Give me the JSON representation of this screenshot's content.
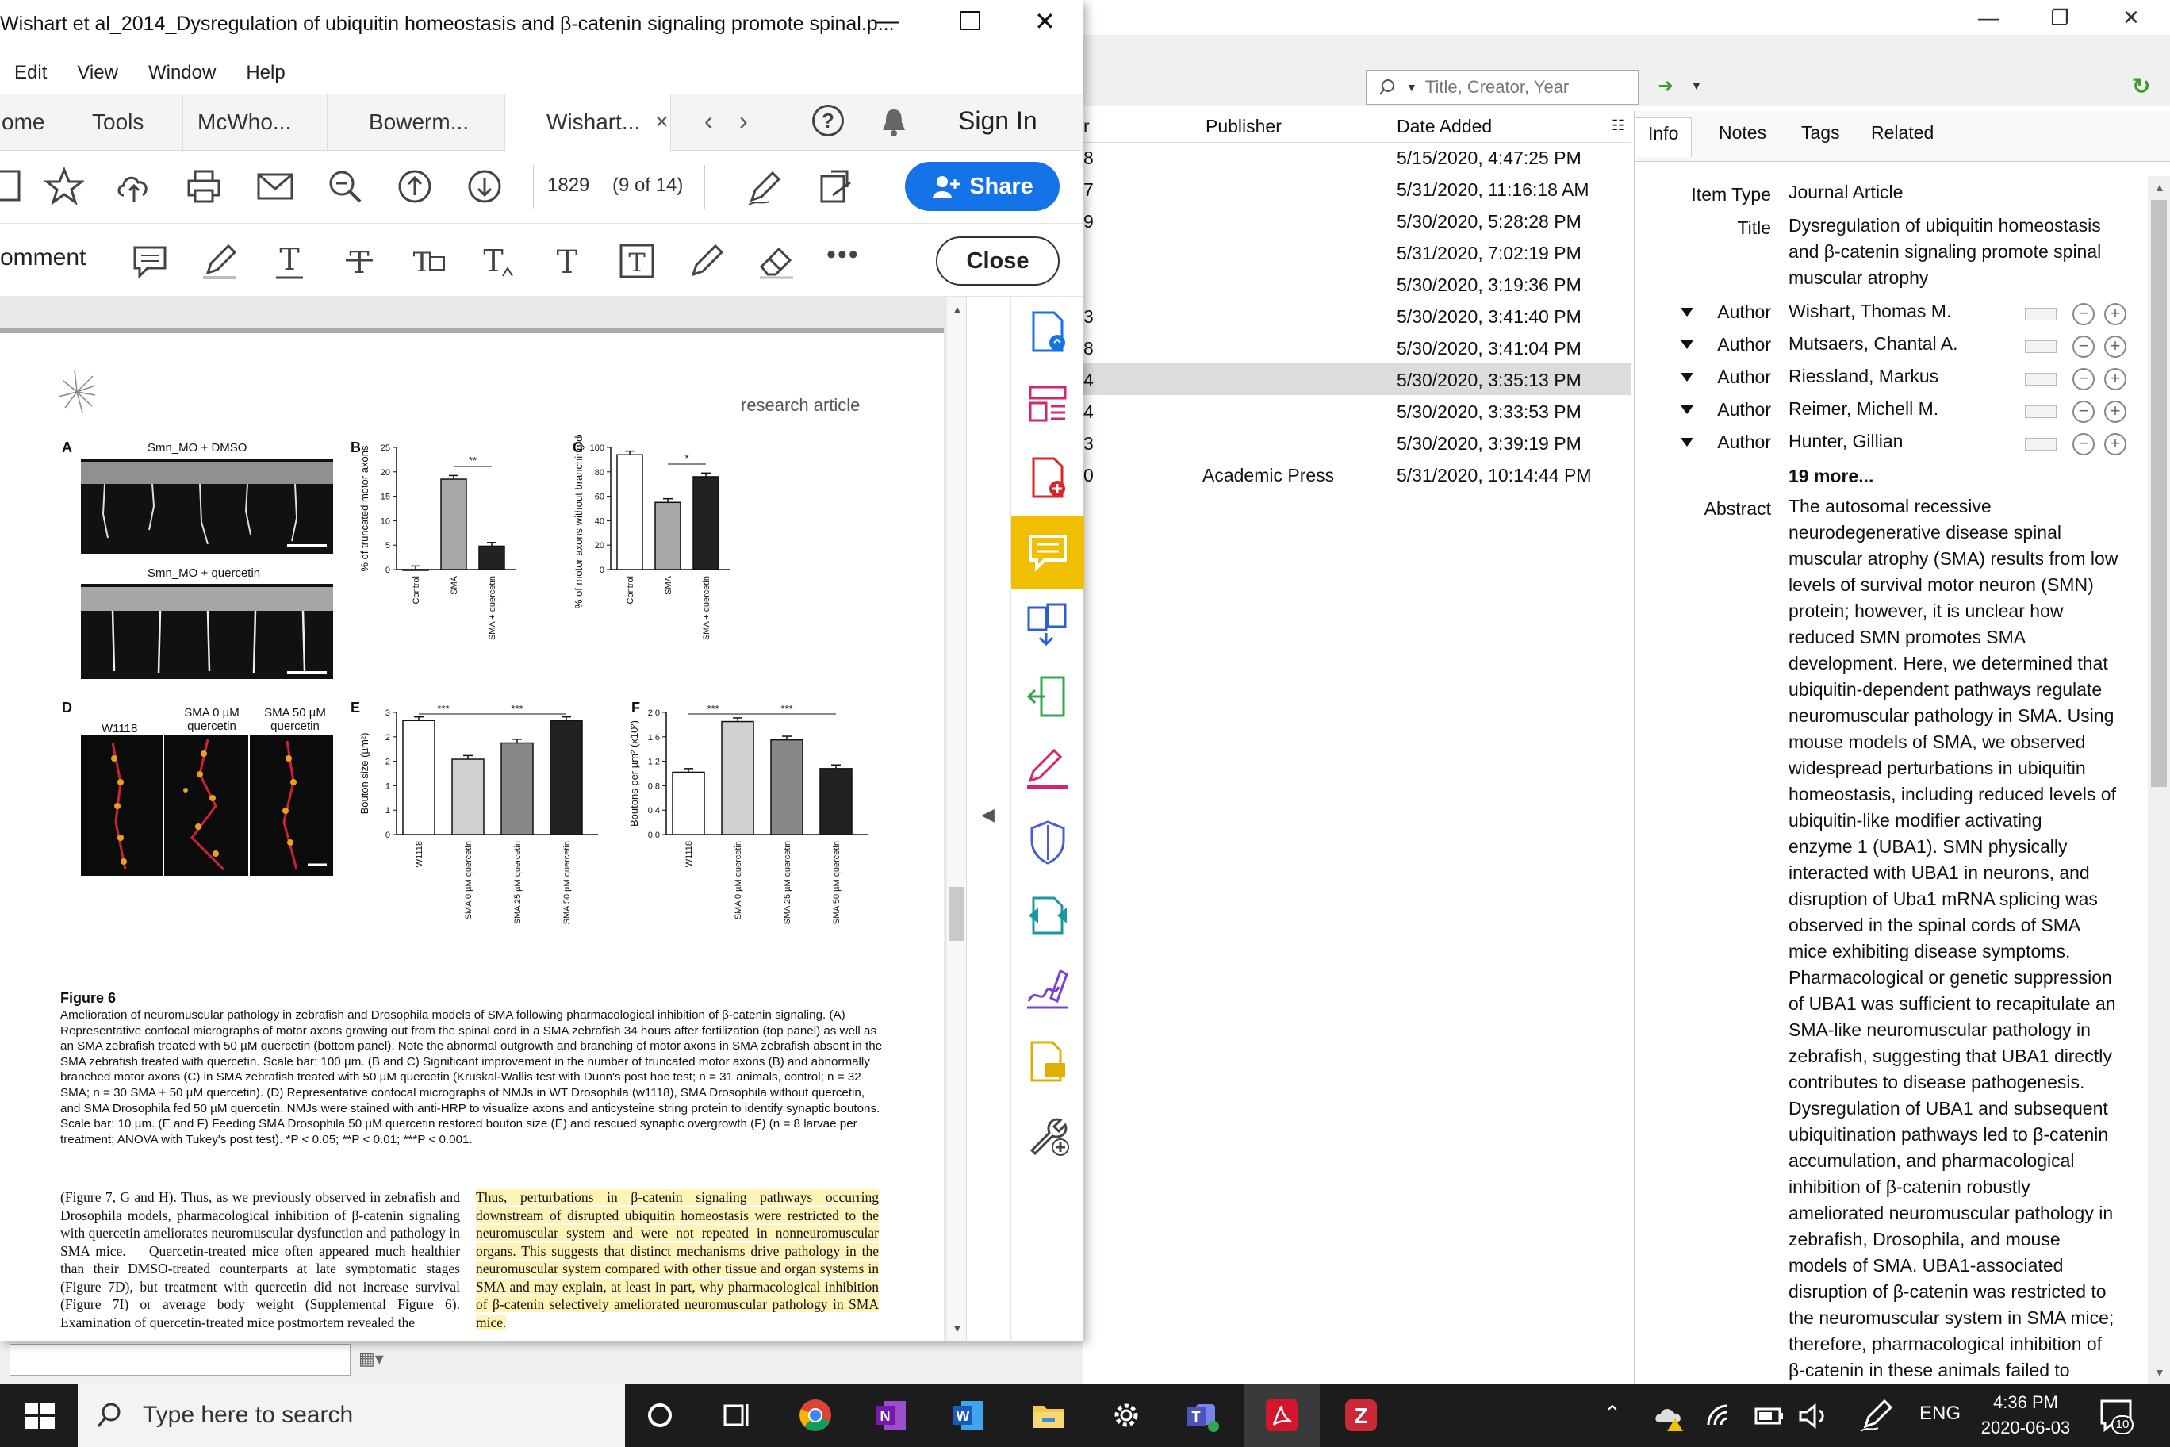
{
  "zotero": {
    "search_placeholder": "Title, Creator, Year",
    "columns": {
      "left_partial": "r",
      "publisher": "Publisher",
      "date_added": "Date Added"
    },
    "rows": [
      {
        "left": "8",
        "publisher": "",
        "date": "5/15/2020, 4:47:25 PM"
      },
      {
        "left": "7",
        "publisher": "",
        "date": "5/31/2020, 11:16:18 AM"
      },
      {
        "left": "9",
        "publisher": "",
        "date": "5/30/2020, 5:28:28 PM"
      },
      {
        "left": "",
        "publisher": "",
        "date": "5/31/2020, 7:02:19 PM"
      },
      {
        "left": "",
        "publisher": "",
        "date": "5/30/2020, 3:19:36 PM"
      },
      {
        "left": "3",
        "publisher": "",
        "date": "5/30/2020, 3:41:40 PM"
      },
      {
        "left": "8",
        "publisher": "",
        "date": "5/30/2020, 3:41:04 PM"
      },
      {
        "left": "4",
        "publisher": "",
        "date": "5/30/2020, 3:35:13 PM"
      },
      {
        "left": "4",
        "publisher": "",
        "date": "5/30/2020, 3:33:53 PM"
      },
      {
        "left": "3",
        "publisher": "",
        "date": "5/30/2020, 3:39:19 PM"
      },
      {
        "left": "0",
        "publisher": "Academic Press",
        "date": "5/31/2020, 10:14:44 PM"
      }
    ],
    "tabs": [
      "Info",
      "Notes",
      "Tags",
      "Related"
    ],
    "info": {
      "item_type_label": "Item Type",
      "item_type": "Journal Article",
      "title_label": "Title",
      "title_lines": [
        "Dysregulation of ubiquitin homeostasis",
        "and β-catenin signaling promote spinal",
        "muscular atrophy"
      ],
      "author_label": "Author",
      "authors": [
        "Wishart, Thomas M.",
        "Mutsaers, Chantal A.",
        "Riessland, Markus",
        "Reimer, Michell M.",
        "Hunter, Gillian"
      ],
      "more": "19 more...",
      "abstract_label": "Abstract",
      "abstract_lines": [
        "The autosomal recessive",
        "neurodegenerative disease spinal",
        "muscular atrophy (SMA) results from low",
        "levels of survival motor neuron (SMN)",
        "protein; however, it is unclear how",
        "reduced SMN promotes SMA",
        "development. Here, we determined that",
        "ubiquitin-dependent pathways regulate",
        "neuromuscular pathology in SMA. Using",
        "mouse models of SMA, we observed",
        "widespread perturbations in ubiquitin",
        "homeostasis, including reduced levels of",
        "ubiquitin-like modifier activating",
        "enzyme 1 (UBA1). SMN physically",
        "interacted with UBA1 in neurons, and",
        "disruption of Uba1 mRNA splicing was",
        "observed in the spinal cords of SMA",
        "mice exhibiting disease symptoms.",
        "Pharmacological or genetic suppression",
        "of UBA1 was sufficient to recapitulate an",
        "SMA-like neuromuscular pathology in",
        "zebrafish, suggesting that UBA1 directly",
        "contributes to disease pathogenesis.",
        "Dysregulation of UBA1 and subsequent",
        "ubiquitination pathways led to β-catenin",
        "accumulation, and pharmacological",
        "inhibition of β-catenin robustly",
        "ameliorated neuromuscular pathology in",
        "zebrafish, Drosophila, and mouse",
        "models of SMA. UBA1-associated",
        "disruption of β-catenin was restricted to",
        "the neuromuscular system in SMA mice;",
        "therefore, pharmacological inhibition of",
        "β-catenin in these animals failed to"
      ]
    }
  },
  "acrobat": {
    "title": "Wishart et al_2014_Dysregulation of ubiquitin homeostasis and β-catenin signaling promote spinal.p...",
    "menu": [
      "Edit",
      "View",
      "Window",
      "Help"
    ],
    "tabs": {
      "home": "ome",
      "tools": "Tools",
      "tab1": "McWho...",
      "tab2": "Bowerm...",
      "tab3": "Wishart..."
    },
    "sign_in": "Sign In",
    "page_number": "1829",
    "page_of": "(9 of 14)",
    "share": "Share",
    "comment": "omment",
    "close": "Close",
    "page": {
      "research_article": "research article",
      "panelA_top": "Smn_MO + DMSO",
      "panelA_bottom": "Smn_MO + quercetin",
      "panelD_labels": [
        "W1118",
        "SMA 0 µM quercetin",
        "SMA 50 µM quercetin"
      ],
      "figure_title": "Figure 6",
      "caption": "Amelioration of neuromuscular pathology in zebrafish and Drosophila models of SMA following pharmacological inhibition of β-catenin signaling. (A) Representative confocal micrographs of motor axons growing out from the spinal cord in a SMA zebrafish 34 hours after fertilization (top panel) as well as an SMA zebrafish treated with 50 µM quercetin (bottom panel). Note the abnormal outgrowth and branching of motor axons in SMA zebrafish absent in the SMA zebrafish treated with quercetin. Scale bar: 100 µm. (B and C) Significant improvement in the number of truncated motor axons (B) and abnormally branched motor axons (C) in SMA zebrafish treated with 50 µM quercetin (Kruskal-Wallis test with Dunn's post hoc test; n = 31 animals, control; n = 32 SMA; n = 30 SMA + 50 µM quercetin). (D) Representative confocal micrographs of NMJs in WT Drosophila (w1118), SMA Drosophila without quercetin, and SMA Drosophila fed 50 µM quercetin. NMJs were stained with anti-HRP to visualize axons and anticysteine string protein to identify synaptic boutons. Scale bar: 10 µm. (E and F) Feeding SMA Drosophila 50 µM quercetin restored bouton size (E) and rescued synaptic overgrowth (F) (n = 8 larvae per treatment; ANOVA with Tukey's post test). *P < 0.05; **P < 0.01; ***P < 0.001.",
      "left_col": "(Figure 7, G and H). Thus, as we previously observed in zebrafish and Drosophila models, pharmacological inhibition of β-catenin signaling with quercetin ameliorates neuromuscular dysfunction and pathology in SMA mice.    Quercetin-treated mice often appeared much healthier than their DMSO-treated counterparts at late symptomatic stages (Figure 7D), but treatment with quercetin did not increase survival (Figure 7I) or average body weight (Supplemental Figure 6). Examination of quercetin-treated mice postmortem revealed the",
      "right_col": "Thus, perturbations in β-catenin signaling pathways occurring downstream of disrupted ubiquitin homeostasis were restricted to the neuromuscular system and were not repeated in nonneuromuscular organs. This suggests that distinct mechanisms drive pathology in the neuromuscular system compared with other tissue and organ systems in SMA and may explain, at least in part, why pharmacological inhibition of β-catenin selectively ameliorated neuromuscular pathology in SMA mice."
    }
  },
  "chart_data": [
    {
      "type": "bar",
      "panel": "B",
      "categories": [
        "Control",
        "SMA",
        "SMA + quercetin"
      ],
      "values": [
        0,
        18.5,
        4.8
      ],
      "ylabel": "% of truncated motor axons",
      "ylim": [
        0,
        25
      ],
      "colors": [
        "#ffffff",
        "#a8a8a8",
        "#222222"
      ],
      "significance": [
        "**"
      ]
    },
    {
      "type": "bar",
      "panel": "C",
      "categories": [
        "Control",
        "SMA",
        "SMA + quercetin"
      ],
      "values": [
        94,
        55,
        76
      ],
      "ylabel": "% of motor axons without branching defects",
      "ylim": [
        0,
        100
      ],
      "colors": [
        "#ffffff",
        "#a8a8a8",
        "#222222"
      ],
      "significance": [
        "*"
      ]
    },
    {
      "type": "bar",
      "panel": "E",
      "categories": [
        "W1118",
        "SMA 0 µM quercetin",
        "SMA 25 µM quercetin",
        "SMA 50 µM quercetin"
      ],
      "values": [
        2.8,
        1.85,
        2.25,
        2.8
      ],
      "ylabel": "Bouton size (µm²)",
      "ylim": [
        0,
        3
      ],
      "colors": [
        "#ffffff",
        "#d0d0d0",
        "#888888",
        "#222222"
      ],
      "significance": [
        "***",
        "***"
      ]
    },
    {
      "type": "bar",
      "panel": "F",
      "categories": [
        "W1118",
        "SMA 0 µM quercetin",
        "SMA 25 µM quercetin",
        "SMA 50 µM quercetin"
      ],
      "values": [
        1.02,
        1.85,
        1.55,
        1.08
      ],
      "ylabel": "Boutons per µm² (x10²)",
      "ylim": [
        0,
        2.0
      ],
      "colors": [
        "#ffffff",
        "#d0d0d0",
        "#888888",
        "#222222"
      ],
      "significance": [
        "***",
        "***"
      ]
    }
  ],
  "taskbar": {
    "search": "Type here to search",
    "lang": "ENG",
    "time": "4:36 PM",
    "date": "2020-06-03",
    "notifications": "10"
  }
}
